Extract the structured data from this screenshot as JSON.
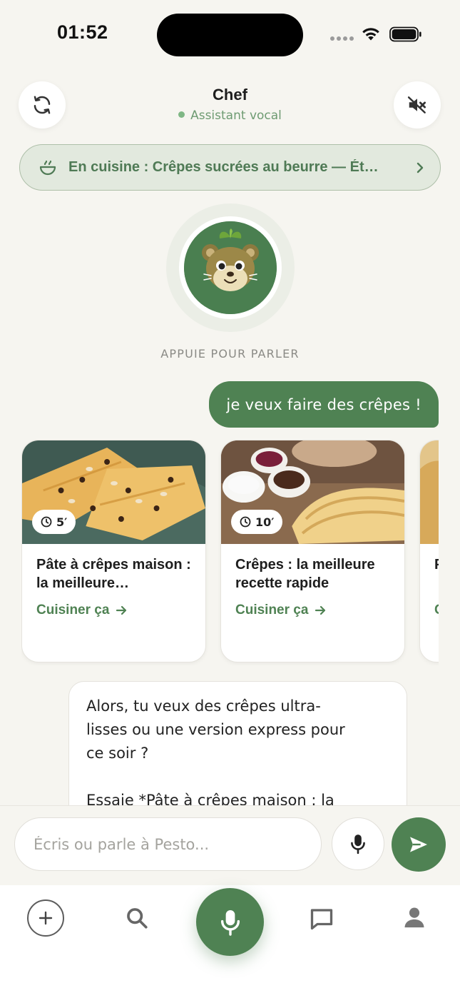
{
  "status_bar": {
    "time": "01:52"
  },
  "header": {
    "title": "Chef",
    "subtitle": "Assistant vocal",
    "status_color": "#7fb785"
  },
  "cooking_banner": {
    "text": "En cuisine : Crêpes sucrées au beurre — Ét…",
    "icon": "bowl-icon"
  },
  "avatar": {
    "tap_label": "APPUIE POUR PARLER"
  },
  "messages": {
    "user": "je veux faire des crêpes !",
    "assistant": "Alors, tu veux des crêpes ultra-\nlisses ou une version express pour\nce soir ?\n\nEssaie *Pâte à crêpes maison : la"
  },
  "recipes": [
    {
      "time": "5′",
      "title": "Pâte à crêpes maison : la meilleure…",
      "cta": "Cuisiner ça"
    },
    {
      "time": "10′",
      "title": "Crêpes : la meilleure recette rapide",
      "cta": "Cuisiner ça"
    },
    {
      "time": "",
      "title": "P r",
      "cta": "C"
    }
  ],
  "composer": {
    "placeholder": "Écris ou parle à Pesto..."
  },
  "colors": {
    "brand_green": "#4f8253",
    "background": "#f6f5f0"
  },
  "tab_bar": {
    "icons": [
      "plus-icon",
      "search-icon",
      "microphone-icon",
      "chat-icon",
      "profile-icon"
    ]
  }
}
